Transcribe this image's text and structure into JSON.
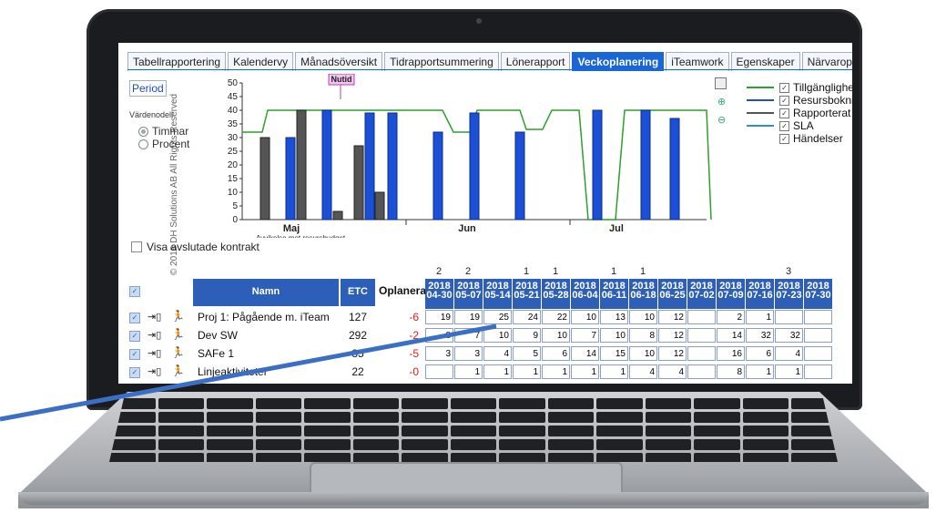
{
  "tabs": [
    "Tabellrapportering",
    "Kalendervy",
    "Månadsöversikt",
    "Tidrapportsummering",
    "Lönerapport",
    "Veckoplanering",
    "iTeamwork",
    "Egenskaper",
    "Närvaroplan"
  ],
  "active_tab": "Veckoplanering",
  "side_text": "© 2018 DH Solutions AB All Rights Reserved",
  "period_label": "Period",
  "value_model_label": "Värdenodell",
  "radio_hours": "Timmar",
  "radio_percent": "Procent",
  "nutid_label": "Nutid",
  "chart_subtitle": "Avvikelse mot resursbudget",
  "legend": [
    {
      "label": "Tillgänglighet",
      "color": "#2aa12a"
    },
    {
      "label": "Resursbokning",
      "color": "#1b4fd6"
    },
    {
      "label": "Rapporterat",
      "color": "#555555"
    },
    {
      "label": "SLA",
      "color": "#2b8fd6"
    },
    {
      "label": "Händelser",
      "color": ""
    }
  ],
  "closed_contracts_label": "Visa avslutade kontrakt",
  "table": {
    "headers": {
      "name": "Namn",
      "etc": "ETC",
      "unplanned": "Oplanerat"
    },
    "top_numbers": [
      "2",
      "2",
      "",
      "1",
      "1",
      "",
      "1",
      "1",
      "",
      "",
      "",
      "",
      "3",
      ""
    ],
    "weeks": [
      [
        "2018",
        "04-30"
      ],
      [
        "2018",
        "05-07"
      ],
      [
        "2018",
        "05-14"
      ],
      [
        "2018",
        "05-21"
      ],
      [
        "2018",
        "05-28"
      ],
      [
        "2018",
        "06-04"
      ],
      [
        "2018",
        "06-11"
      ],
      [
        "2018",
        "06-18"
      ],
      [
        "2018",
        "06-25"
      ],
      [
        "2018",
        "07-02"
      ],
      [
        "2018",
        "07-09"
      ],
      [
        "2018",
        "07-16"
      ],
      [
        "2018",
        "07-23"
      ],
      [
        "2018",
        "07-30"
      ]
    ],
    "rows": [
      {
        "name": "Proj 1: Pågående m. iTeam",
        "etc": "127",
        "unplanned": "-6",
        "cells": [
          "19",
          "19",
          "25",
          "24",
          "22",
          "10",
          "13",
          "10",
          "12",
          "",
          "2",
          "1",
          "",
          ""
        ]
      },
      {
        "name": "Dev SW",
        "etc": "292",
        "unplanned": "-2",
        "cells": [
          "8",
          "7",
          "10",
          "9",
          "10",
          "7",
          "10",
          "8",
          "12",
          "",
          "14",
          "32",
          "32",
          ""
        ]
      },
      {
        "name": "SAFe 1",
        "etc": "85",
        "unplanned": "-5",
        "cells": [
          "3",
          "3",
          "4",
          "5",
          "6",
          "14",
          "15",
          "10",
          "12",
          "",
          "16",
          "6",
          "4",
          ""
        ]
      },
      {
        "name": "Linjeaktiviteter",
        "etc": "22",
        "unplanned": "-0",
        "cells": [
          "",
          "1",
          "1",
          "1",
          "1",
          "1",
          "1",
          "4",
          "4",
          "",
          "8",
          "1",
          "1",
          ""
        ]
      }
    ]
  },
  "chart_data": {
    "type": "bar",
    "title": "",
    "xlabel": "",
    "ylabel": "",
    "ylim": [
      0,
      50
    ],
    "yticks": [
      "0",
      "5",
      "10",
      "15",
      "20",
      "25",
      "30",
      "35",
      "40",
      "45",
      "50"
    ],
    "months": [
      "Maj",
      "Jun",
      "Jul"
    ],
    "series": [
      {
        "name": "Resursbokning",
        "color": "#1b4fd6",
        "values": [
          30,
          40,
          39,
          39,
          32,
          39,
          32,
          40,
          40,
          37
        ]
      },
      {
        "name": "Rapporterat",
        "color": "#555555",
        "values": [
          30,
          40,
          3,
          27,
          10
        ]
      }
    ],
    "availability_line": "Tillgänglighet"
  }
}
